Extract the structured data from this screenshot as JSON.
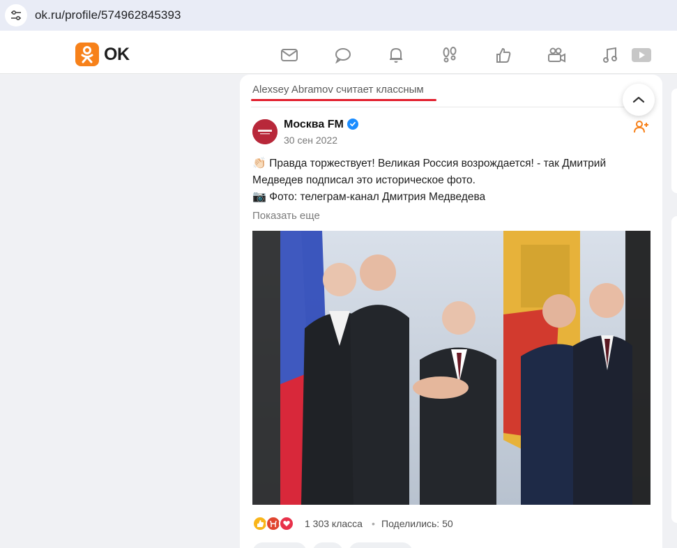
{
  "browser": {
    "url": "ok.ru/profile/574962845393"
  },
  "header": {
    "logo_text": "OK",
    "nav_icons": [
      "messages-icon",
      "discussions-icon",
      "notifications-icon",
      "guests-icon",
      "likes-icon",
      "video-icon",
      "music-icon",
      "video-player-icon"
    ]
  },
  "post": {
    "liked_by": "Alexsey Abramov считает классным",
    "author": "Москва FM",
    "date": "30 сен 2022",
    "text_line1": "Правда торжествует! Великая Россия возрождается! - так Дмитрий Медведев подписал это историческое фото.",
    "text_line2": "Фото: телеграм-канал Дмитрия Медведева",
    "emoji1": "👏🏻",
    "emoji2": "📷",
    "show_more": "Показать еще",
    "likes_count": "1 303 класса",
    "separator": "•",
    "shares": "Поделились: 50"
  },
  "colors": {
    "accent": "#f7811a",
    "underline": "#e21d2c",
    "verified": "#1a8cff"
  }
}
